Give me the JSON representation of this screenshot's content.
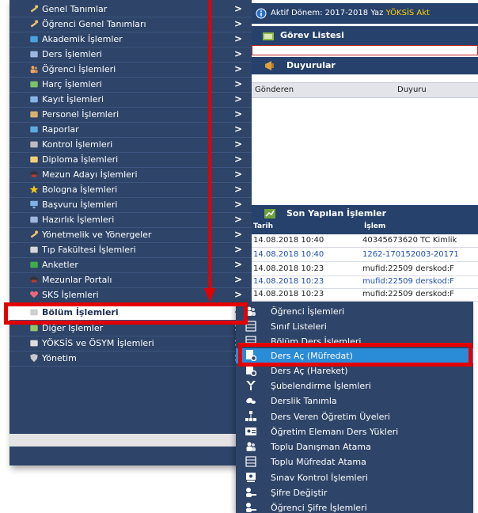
{
  "menu": {
    "items": [
      {
        "label": "Genel Tanımlar",
        "icon": "wrench-icon",
        "chevron": ">"
      },
      {
        "label": "Öğrenci Genel Tanımları",
        "icon": "wrench-icon",
        "chevron": ">"
      },
      {
        "label": "Akademik İşlemler",
        "icon": "graduation-icon",
        "chevron": ">"
      },
      {
        "label": "Ders İşlemleri",
        "icon": "book-icon",
        "chevron": ">"
      },
      {
        "label": "Öğrenci İşlemleri",
        "icon": "users-icon",
        "chevron": ">"
      },
      {
        "label": "Harç İşlemleri",
        "icon": "money-icon",
        "chevron": ">"
      },
      {
        "label": "Kayıt İşlemleri",
        "icon": "register-icon",
        "chevron": ">"
      },
      {
        "label": "Personel İşlemleri",
        "icon": "staff-icon",
        "chevron": ">"
      },
      {
        "label": "Raporlar",
        "icon": "report-icon",
        "chevron": ">"
      },
      {
        "label": "Kontrol İşlemleri",
        "icon": "control-icon",
        "chevron": ">"
      },
      {
        "label": "Diploma İşlemleri",
        "icon": "diploma-icon",
        "chevron": ">"
      },
      {
        "label": "Mezun Adayı İşlemleri",
        "icon": "cap-icon",
        "chevron": ">"
      },
      {
        "label": "Bologna İşlemleri",
        "icon": "star-icon",
        "chevron": ">"
      },
      {
        "label": "Başvuru İşlemleri",
        "icon": "monitor-icon",
        "chevron": ">"
      },
      {
        "label": "Hazırlık İşlemleri",
        "icon": "book-icon",
        "chevron": ">"
      },
      {
        "label": "Yönetmelik ve Yönergeler",
        "icon": "wrench-icon",
        "chevron": ">"
      },
      {
        "label": "Tıp Fakültesi İşlemleri",
        "icon": "medical-icon",
        "chevron": ">"
      },
      {
        "label": "Anketler",
        "icon": "survey-icon",
        "chevron": ">"
      },
      {
        "label": "Mezunlar Portalı",
        "icon": "cap-icon",
        "chevron": ">"
      },
      {
        "label": "SKS İşlemleri",
        "icon": "heart-icon",
        "chevron": ">"
      },
      {
        "label": "Bölüm İşlemleri",
        "icon": "department-icon",
        "chevron": "<"
      },
      {
        "label": "Diğer İşlemler",
        "icon": "other-icon",
        "chevron": ">"
      },
      {
        "label": "YÖKSİS ve ÖSYM İşlemleri",
        "icon": "yoksis-icon",
        "chevron": ">"
      },
      {
        "label": "Yönetim",
        "icon": "shield-icon",
        "chevron": ">"
      }
    ]
  },
  "header": {
    "term_prefix": "Aktif Dönem: 2017-2018 Yaz ",
    "term_highlight": "YÖKSİS Akt",
    "info_icon": "info-icon"
  },
  "panels": {
    "tasks_title": "Görev Listesi",
    "announcements_title": "Duyurular",
    "announcements_columns": [
      "Gönderen",
      "Duyuru"
    ],
    "recent_title": "Son Yapılan İşlemler",
    "recent_columns": [
      "Tarih",
      "İşlem"
    ],
    "recent_rows": [
      {
        "date": "14.08.2018 10:40",
        "action": "40345673620 TC Kimlik",
        "color": "#222222"
      },
      {
        "date": "14.08.2018 10:40",
        "action": "1262-170152003-20171",
        "color": "#1f4fb0"
      },
      {
        "date": "14.08.2018 10:23",
        "action": "mufid:22509 derskod:F",
        "color": "#222222"
      },
      {
        "date": "14.08.2018 10:23",
        "action": "mufid:22509 derskod:F",
        "color": "#1f4fb0"
      },
      {
        "date": "14.08.2018 10:23",
        "action": "mufid:22509 derskod:F",
        "color": "#222222"
      }
    ]
  },
  "submenu": {
    "items": [
      {
        "label": "Öğrenci İşlemleri",
        "icon": "students-icon"
      },
      {
        "label": "Sınıf Listeleri",
        "icon": "list-icon"
      },
      {
        "label": "Bölüm Ders İşlemleri",
        "icon": "columns-icon"
      },
      {
        "label": "Ders Aç (Müfredat)",
        "icon": "course-open-icon"
      },
      {
        "label": "Ders Aç (Hareket)",
        "icon": "course-open-icon"
      },
      {
        "label": "Şubelendirme İşlemleri",
        "icon": "branch-icon"
      },
      {
        "label": "Derslik Tanımla",
        "icon": "classroom-icon"
      },
      {
        "label": "Ders Veren Öğretim Üyeleri",
        "icon": "hierarchy-icon"
      },
      {
        "label": "Öğretim Elemanı Ders Yükleri",
        "icon": "id-card-icon"
      },
      {
        "label": "Toplu Danışman Atama",
        "icon": "group-icon"
      },
      {
        "label": "Toplu Müfredat Atama",
        "icon": "table-icon"
      },
      {
        "label": "Sınav Kontrol İşlemleri",
        "icon": "exam-icon"
      },
      {
        "label": "Şifre Değiştir",
        "icon": "key-user-icon"
      },
      {
        "label": "Öğrenci Şifre İşlemleri",
        "icon": "key-user-icon"
      }
    ]
  },
  "colors": {
    "sidebar_bg": "#2e4468",
    "header_bar": "#26416b",
    "submenu_active": "#2a8bd6",
    "highlight_box": "#e30000",
    "term_highlight": "#ffd200"
  }
}
